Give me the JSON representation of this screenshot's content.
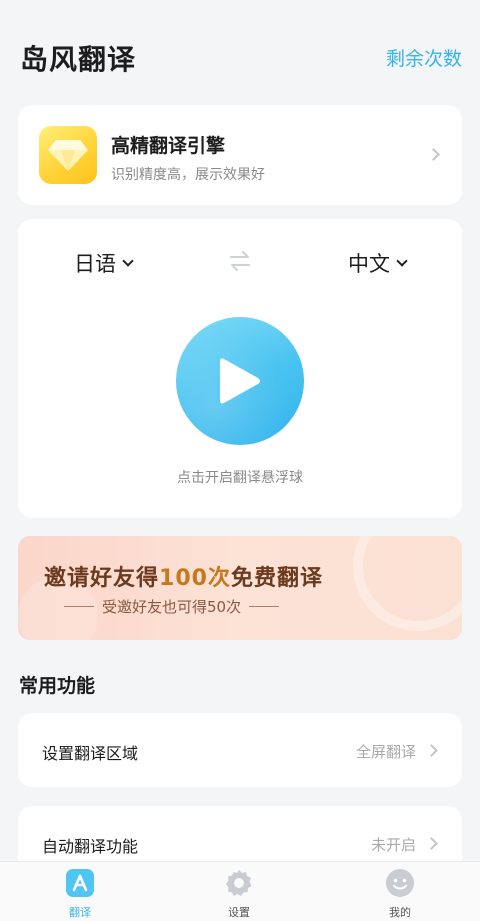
{
  "header": {
    "title": "岛风翻译",
    "remaining_label": "剩余次数"
  },
  "engine": {
    "icon": "diamond-icon",
    "title": "高精翻译引擎",
    "subtitle": "识别精度高，展示效果好"
  },
  "translator": {
    "source_lang": "日语",
    "target_lang": "中文",
    "hint": "点击开启翻译悬浮球"
  },
  "banner": {
    "title_prefix": "邀请好友得",
    "title_highlight": "100次",
    "title_suffix": "免费翻译",
    "subtitle": "受邀好友也可得50次"
  },
  "features": {
    "title": "常用功能",
    "items": [
      {
        "label": "设置翻译区域",
        "value": "全屏翻译"
      },
      {
        "label": "自动翻译功能",
        "value": "未开启"
      }
    ]
  },
  "tabbar": {
    "items": [
      {
        "label": "翻译",
        "icon": "translate-icon",
        "active": true
      },
      {
        "label": "设置",
        "icon": "gear-icon",
        "active": false
      },
      {
        "label": "我的",
        "icon": "smile-icon",
        "active": false
      }
    ]
  },
  "colors": {
    "accent": "#36b6e6",
    "banner_text": "#6b3a1f",
    "banner_highlight": "#c4791f"
  }
}
